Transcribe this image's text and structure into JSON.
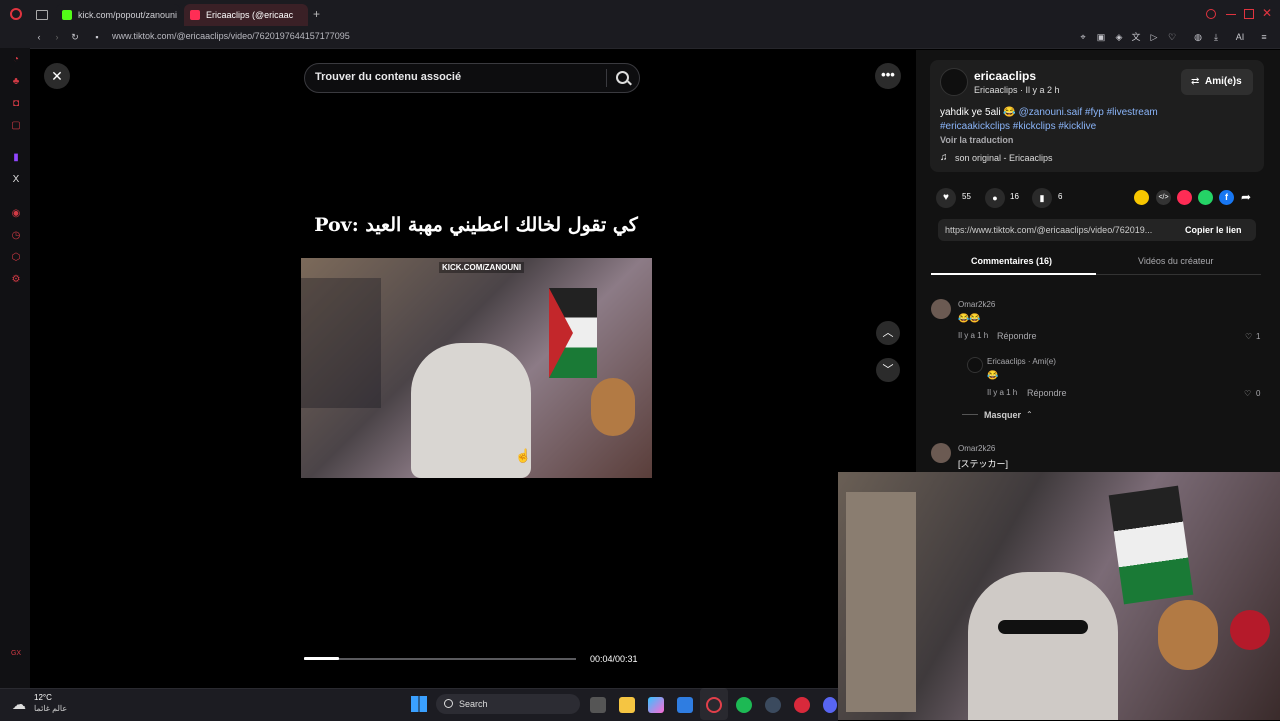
{
  "browser": {
    "tabs": [
      {
        "label": "kick.com/popout/zanouni",
        "favicon_color": "#53fc18"
      },
      {
        "label": "Ericaaclips (@ericaac",
        "favicon_color": "#ff2d55"
      }
    ],
    "url": "www.tiktok.com/@ericaaclips/video/7620197644157177095",
    "ai_label": "AI"
  },
  "video": {
    "search_placeholder": "Trouver du contenu associé",
    "caption_overlay": "كي تقول لخالك اعطيني مهبة العيد :Pov",
    "watermark": "KICK.COM/ZANOUNI",
    "progress_percent": 12.9,
    "time": "00:04/00:31"
  },
  "post": {
    "username": "ericaaclips",
    "display_meta": "Ericaaclips · Il y a 2 h",
    "follow_label": "Ami(e)s",
    "desc_text": "yahdik ye 5ali 😂",
    "mention": "@zanouni.saif",
    "tags_line1": "#fyp #livestream",
    "tags_line2": "#ericaakickclips #kickclips #kicklive",
    "translate": "Voir la traduction",
    "sound": "son original - Ericaaclips",
    "likes": "55",
    "comments": "16",
    "saves": "6",
    "link": "https://www.tiktok.com/@ericaaclips/video/762019...",
    "copy_label": "Copier le lien",
    "tab_comments": "Commentaires (16)",
    "tab_creator": "Vidéos du créateur"
  },
  "comments": [
    {
      "user": "Omar2k26",
      "text": "😂😂",
      "time": "Il y a 1 h",
      "reply": "Répondre",
      "likes": "1"
    },
    {
      "user": "Ericaaclips · Ami(e)",
      "text": "😂",
      "time": "Il y a 1 h",
      "reply": "Répondre",
      "likes": "0"
    },
    {
      "user": "Omar2k26",
      "text": "[ステッカー]"
    }
  ],
  "hide_label": "Masquer",
  "taskbar": {
    "temp": "12°C",
    "weather_text": "عالم غائما",
    "search": "Search"
  },
  "colors": {
    "accent": "#fe2c55",
    "link": "#8ab4f8",
    "panel": "#121212"
  }
}
